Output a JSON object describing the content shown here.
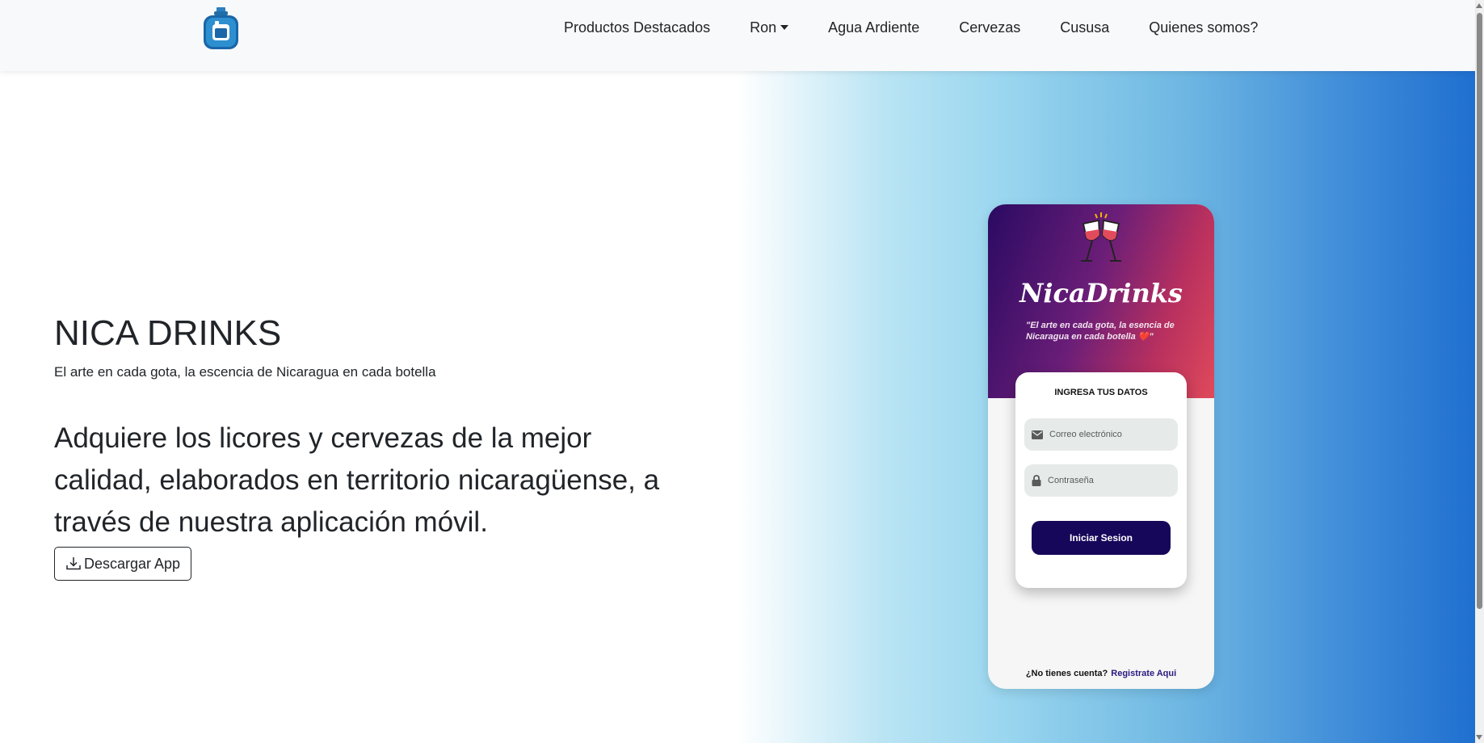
{
  "brand": {
    "logo_icon": "liquor-bottle-icon",
    "colors": {
      "logo_blue": "#1f6ea8",
      "logo_dark": "#0b3f78"
    }
  },
  "nav": {
    "items": [
      {
        "label": "Productos Destacados"
      },
      {
        "label": "Ron",
        "dropdown": true
      },
      {
        "label": "Agua Ardiente"
      },
      {
        "label": "Cervezas"
      },
      {
        "label": "Cususa"
      },
      {
        "label": "Quienes somos?"
      }
    ]
  },
  "hero": {
    "title": "NICA DRINKS",
    "subtitle": "El arte en cada gota, la escencia de Nicaragua en cada botella",
    "lead": "Adquiere los licores y cervezas de la mejor calidad, elaborados en territorio nicaragüense, a través de nuestra aplicación móvil.",
    "download_button": "Descargar App",
    "download_icon": "download-icon",
    "gradient_colors": [
      "#ffffff",
      "#9ad6ef",
      "#1f6fd0"
    ]
  },
  "phone": {
    "app_name": "NicaDrinks",
    "tagline": "\"El arte en cada gota, la esencia de Nicaragua en cada botella ❤️\"",
    "header_icon": "wine-glasses-cheers-icon",
    "card_title": "INGRESA TUS DATOS",
    "email_placeholder": "Correo electrónico",
    "email_icon": "mail-icon",
    "password_placeholder": "Contraseña",
    "password_icon": "lock-icon",
    "login_button": "Iniciar Sesion",
    "register_prompt": "¿No tienes cuenta?",
    "register_link": "Registrate Aqui",
    "colors": {
      "header_start": "#2a0a62",
      "header_end": "#e04a5a",
      "button": "#17075a"
    }
  }
}
